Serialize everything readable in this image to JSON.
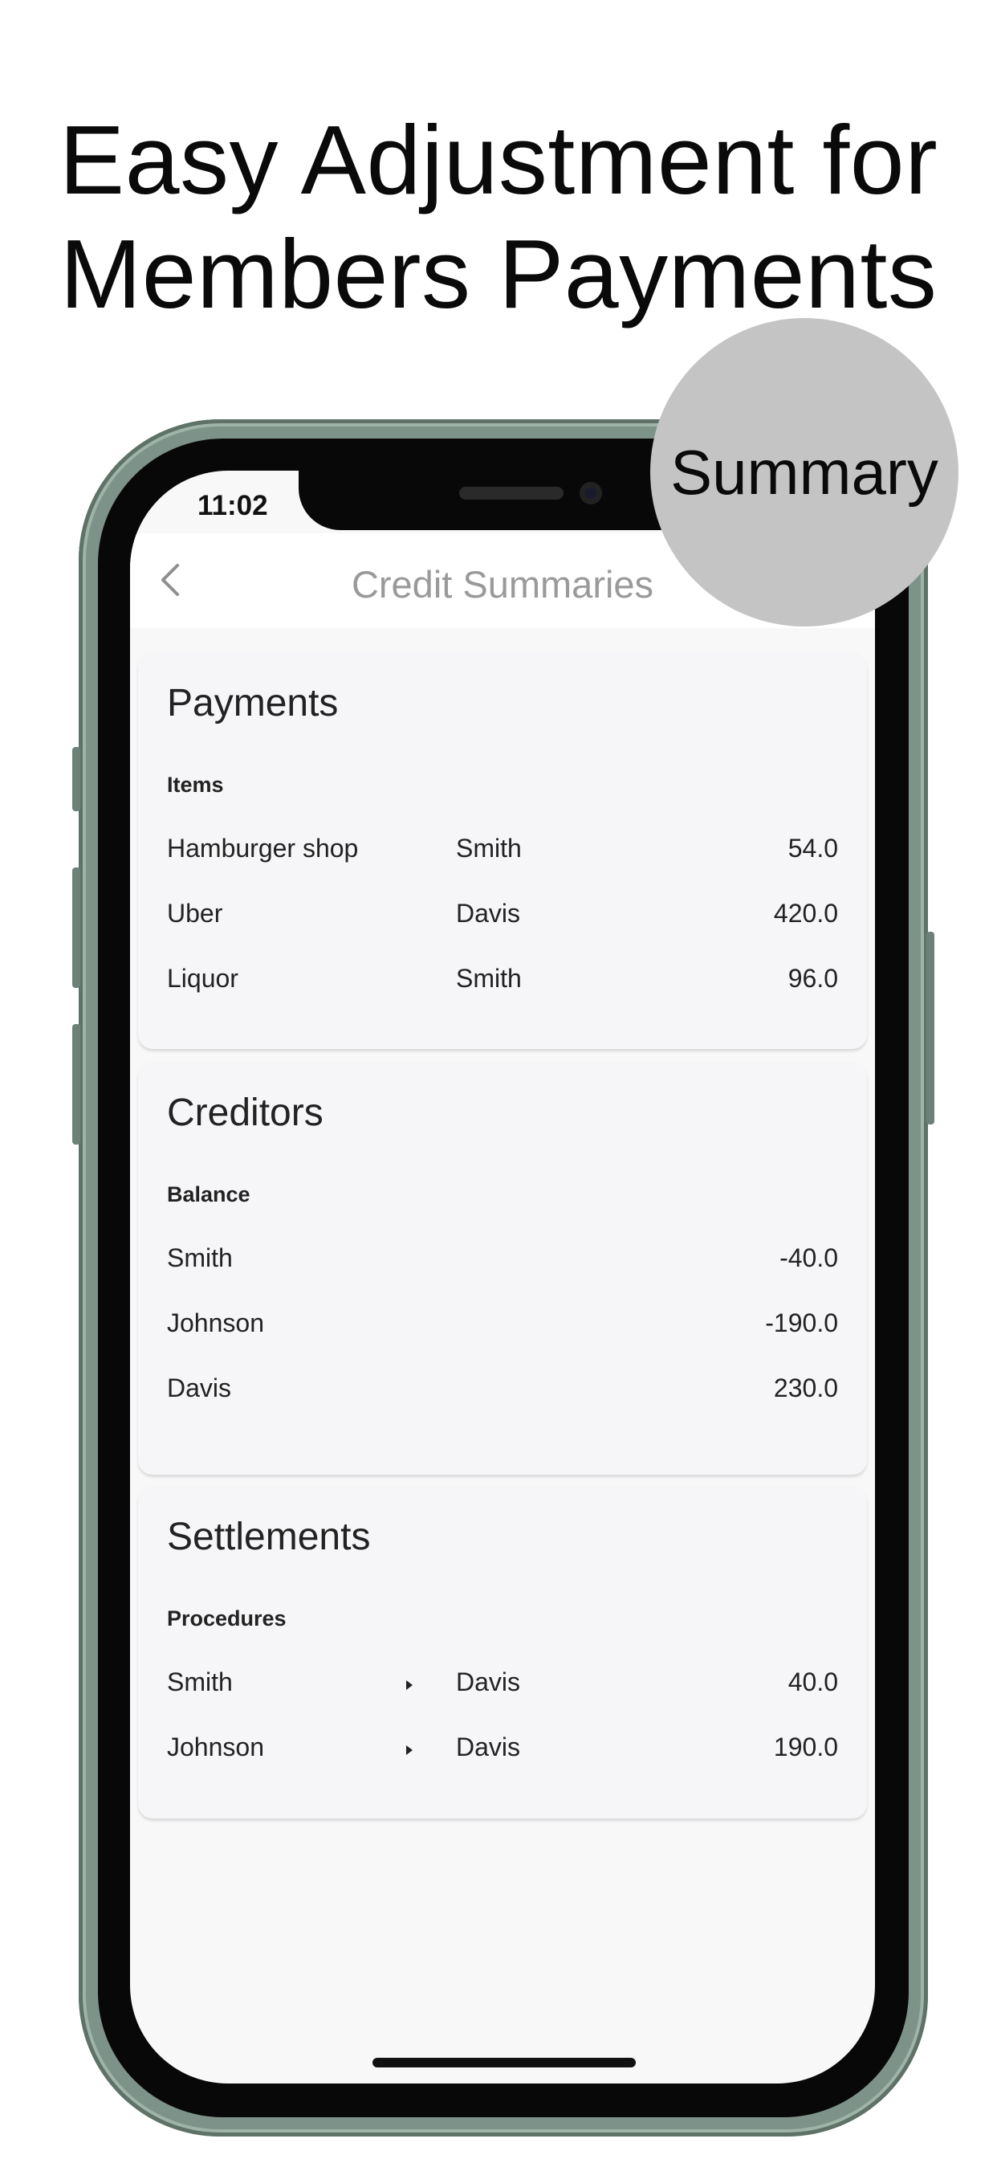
{
  "headline": {
    "line1": "Easy Adjustment for",
    "line2": "Members Payments"
  },
  "badge": {
    "label": "Summary"
  },
  "status_bar": {
    "time": "11:02"
  },
  "header": {
    "title": "Credit Summaries",
    "back_icon": "chevron-left-icon"
  },
  "payments": {
    "title": "Payments",
    "subtitle": "Items",
    "rows": [
      {
        "item": "Hamburger shop",
        "member": "Smith",
        "amount": "54.0"
      },
      {
        "item": "Uber",
        "member": "Davis",
        "amount": "420.0"
      },
      {
        "item": "Liquor",
        "member": "Smith",
        "amount": "96.0"
      }
    ]
  },
  "creditors": {
    "title": "Creditors",
    "subtitle": "Balance",
    "rows": [
      {
        "member": "Smith",
        "balance": "-40.0"
      },
      {
        "member": "Johnson",
        "balance": "-190.0"
      },
      {
        "member": "Davis",
        "balance": "230.0"
      }
    ]
  },
  "settlements": {
    "title": "Settlements",
    "subtitle": "Procedures",
    "rows": [
      {
        "from": "Smith",
        "to": "Davis",
        "amount": "40.0"
      },
      {
        "from": "Johnson",
        "to": "Davis",
        "amount": "190.0"
      }
    ]
  },
  "colors": {
    "background": "#ffffff",
    "phone_frame": "#7d9288",
    "screen_bg": "#f8f8f9",
    "card_bg": "#f6f6f8",
    "badge_bg": "#c4c4c4",
    "header_title": "#9a9a9a"
  }
}
